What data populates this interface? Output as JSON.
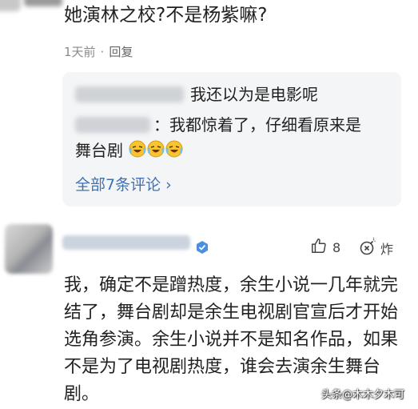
{
  "comment1": {
    "text": "她演林之校?不是杨紫嘛?",
    "time": "1天前",
    "separator": "·",
    "reply_label": "回复"
  },
  "replies": {
    "reply1_text": "我还以为是电影呢",
    "reply2_text": "：我都惊着了，仔细看原来是",
    "reply2_text_cont": "舞台剧",
    "emoji_icon": "laughing-crying-face-icon",
    "view_all": "全部7条评论",
    "view_all_arrow": "›"
  },
  "comment2": {
    "like_count": "8",
    "zha_label": "炸",
    "text": "我，确定不是蹭热度，余生小说一几年就完结了，舞台剧却是余生电视剧官宣后才开始选角参演。余生小说并不是知名作品，如果不是为了电视剧热度，谁会去演余生舞台剧。"
  },
  "watermark": "头条@木木夕木可",
  "colors": {
    "link": "#3f6fb5",
    "reply_bg": "#f4f5f7",
    "meta": "#8a8a8a",
    "verified": "#4a8fe0"
  }
}
